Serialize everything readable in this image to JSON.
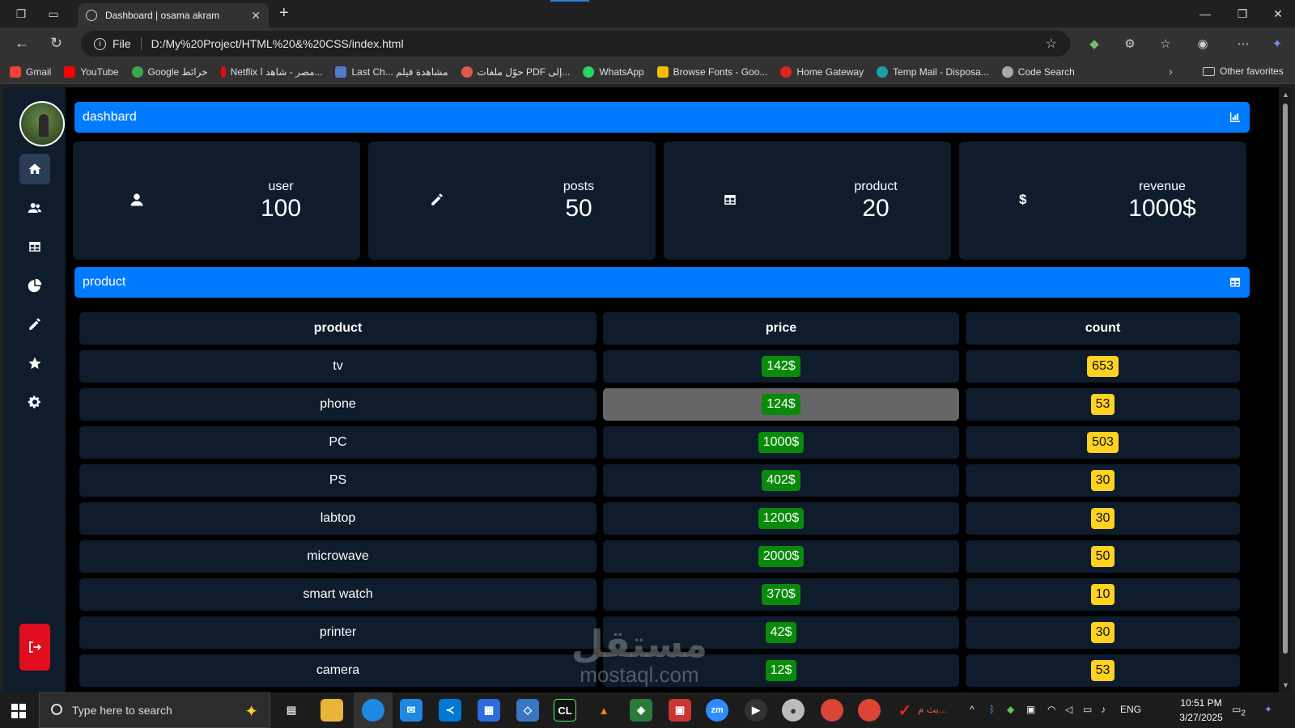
{
  "browser": {
    "tab_title": "Dashboard | osama akram",
    "omnibox_scheme": "File",
    "url": "D:/My%20Project/HTML%20&%20CSS/index.html",
    "bookmarks": [
      {
        "label": "Gmail",
        "color": "#ea4335"
      },
      {
        "label": "YouTube",
        "color": "#ff0000"
      },
      {
        "label": "Google خرائط",
        "color": "#34a853"
      },
      {
        "label": "Netflix مصر - شاهد ا...",
        "color": "#e50914"
      },
      {
        "label": "Last Ch... مشاهدة فيلم",
        "color": "#5577cc"
      },
      {
        "label": "حوّل ملفات PDF إلى...",
        "color": "#e2574c"
      },
      {
        "label": "WhatsApp",
        "color": "#25d366"
      },
      {
        "label": "Browse Fonts - Goo...",
        "color": "#fbbc04"
      },
      {
        "label": "Home Gateway",
        "color": "#e2231a"
      },
      {
        "label": "Temp Mail - Disposa...",
        "color": "#19a0a0"
      },
      {
        "label": "Code Search",
        "color": "#aaaaaa"
      }
    ],
    "other_favorites": "Other favorites"
  },
  "dashboard": {
    "header_title": "dashbard",
    "section_title": "product",
    "stats": [
      {
        "label": "user",
        "value": "100",
        "icon": "user-icon"
      },
      {
        "label": "posts",
        "value": "50",
        "icon": "pencil-icon"
      },
      {
        "label": "product",
        "value": "20",
        "icon": "table-icon"
      },
      {
        "label": "revenue",
        "value": "1000$",
        "icon": "dollar-icon"
      }
    ],
    "sidebar": [
      "home-icon",
      "users-icon",
      "table-icon",
      "pie-chart-icon",
      "pencil-icon",
      "star-icon",
      "gear-icon"
    ],
    "table": {
      "headers": [
        "product",
        "price",
        "count"
      ],
      "rows": [
        {
          "product": "tv",
          "price": "142$",
          "count": "653"
        },
        {
          "product": "phone",
          "price": "124$",
          "count": "53"
        },
        {
          "product": "PC",
          "price": "1000$",
          "count": "503"
        },
        {
          "product": "PS",
          "price": "402$",
          "count": "30"
        },
        {
          "product": "labtop",
          "price": "1200$",
          "count": "30"
        },
        {
          "product": "microwave",
          "price": "2000$",
          "count": "50"
        },
        {
          "product": "smart watch",
          "price": "370$",
          "count": "10"
        },
        {
          "product": "printer",
          "price": "42$",
          "count": "30"
        },
        {
          "product": "camera",
          "price": "12$",
          "count": "53"
        }
      ]
    },
    "colors": {
      "accent": "#007bff",
      "panel": "#0f1c2c",
      "price_badge": "#0a8a0a",
      "count_badge": "#ffd21f",
      "logout": "#e00d1e"
    }
  },
  "watermark": {
    "arabic": "مستقل",
    "latin": "mostaql.com"
  },
  "taskbar": {
    "search_placeholder": "Type here to search",
    "tray_lang": "ENG",
    "time": "10:51 PM",
    "date": "3/27/2025",
    "notification_count": "2",
    "tray_text": "بث م..."
  }
}
